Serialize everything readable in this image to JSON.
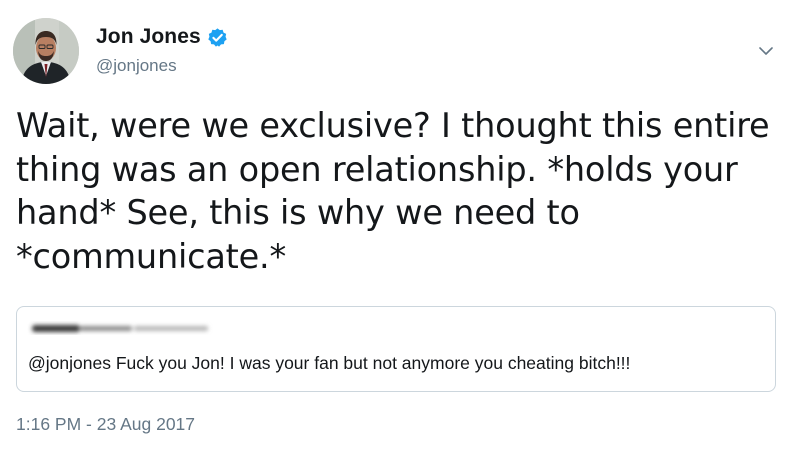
{
  "author": {
    "name": "Jon Jones",
    "handle": "@jonjones",
    "verified": true,
    "verified_color": "#1da1f2"
  },
  "tweet": {
    "text": "Wait, were we exclusive? I thought this entire\nthing was an open relationship. *holds your\nhand* See, this is why we need to\n*communicate.*",
    "timestamp": "1:16 PM - 23 Aug 2017"
  },
  "quoted_tweet": {
    "text": "@jonjones Fuck you Jon! I was your fan but not anymore you cheating bitch!!!"
  },
  "icons": {
    "menu": "chevron-down-icon",
    "verified": "verified-badge-icon"
  },
  "colors": {
    "text_primary": "#14171a",
    "text_secondary": "#657786",
    "border": "#ccd6dd",
    "accent": "#1da1f2"
  }
}
